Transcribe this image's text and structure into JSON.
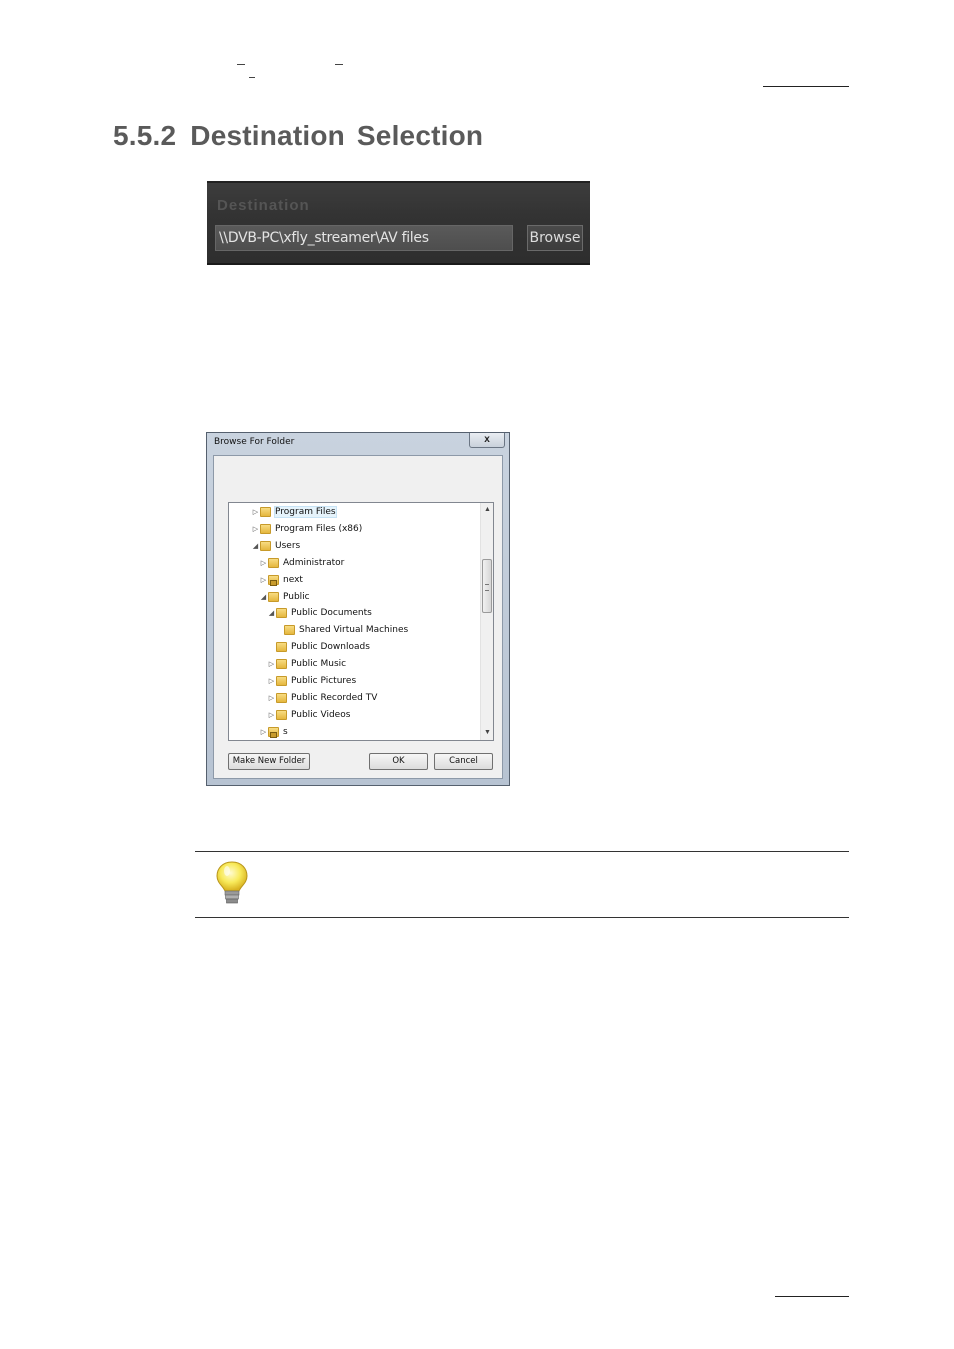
{
  "section": {
    "number": "5.5.2",
    "title": "Destination Selection"
  },
  "destination_panel": {
    "label": "Destination",
    "path": "\\\\DVB-PC\\xfly_streamer\\AV files",
    "browse_label": "Browse"
  },
  "browse_dialog": {
    "title": "Browse For Folder",
    "close_label": "x",
    "tree": [
      {
        "label": "Program Files",
        "expander": "▷",
        "selected": true
      },
      {
        "label": "Program Files (x86)",
        "expander": "▷"
      },
      {
        "label": "Users",
        "expander": "◢"
      },
      {
        "label": "Administrator",
        "expander": "▷"
      },
      {
        "label": "next",
        "expander": "▷",
        "locked": true
      },
      {
        "label": "Public",
        "expander": "◢"
      },
      {
        "label": "Public Documents",
        "expander": "◢"
      },
      {
        "label": "Shared Virtual Machines",
        "expander": ""
      },
      {
        "label": "Public Downloads",
        "expander": ""
      },
      {
        "label": "Public Music",
        "expander": "▷"
      },
      {
        "label": "Public Pictures",
        "expander": "▷"
      },
      {
        "label": "Public Recorded TV",
        "expander": "▷"
      },
      {
        "label": "Public Videos",
        "expander": "▷"
      },
      {
        "label": "s",
        "expander": "▷",
        "locked": true
      }
    ],
    "buttons": {
      "make_new_folder": "Make New Folder",
      "ok": "OK",
      "cancel": "Cancel"
    }
  },
  "icons": {
    "tip": "lightbulb-icon",
    "folder": "folder-icon"
  },
  "colors": {
    "heading": "#5a5a5a",
    "panel_bg": "#333333",
    "dialog_frame": "#c9d3df"
  }
}
